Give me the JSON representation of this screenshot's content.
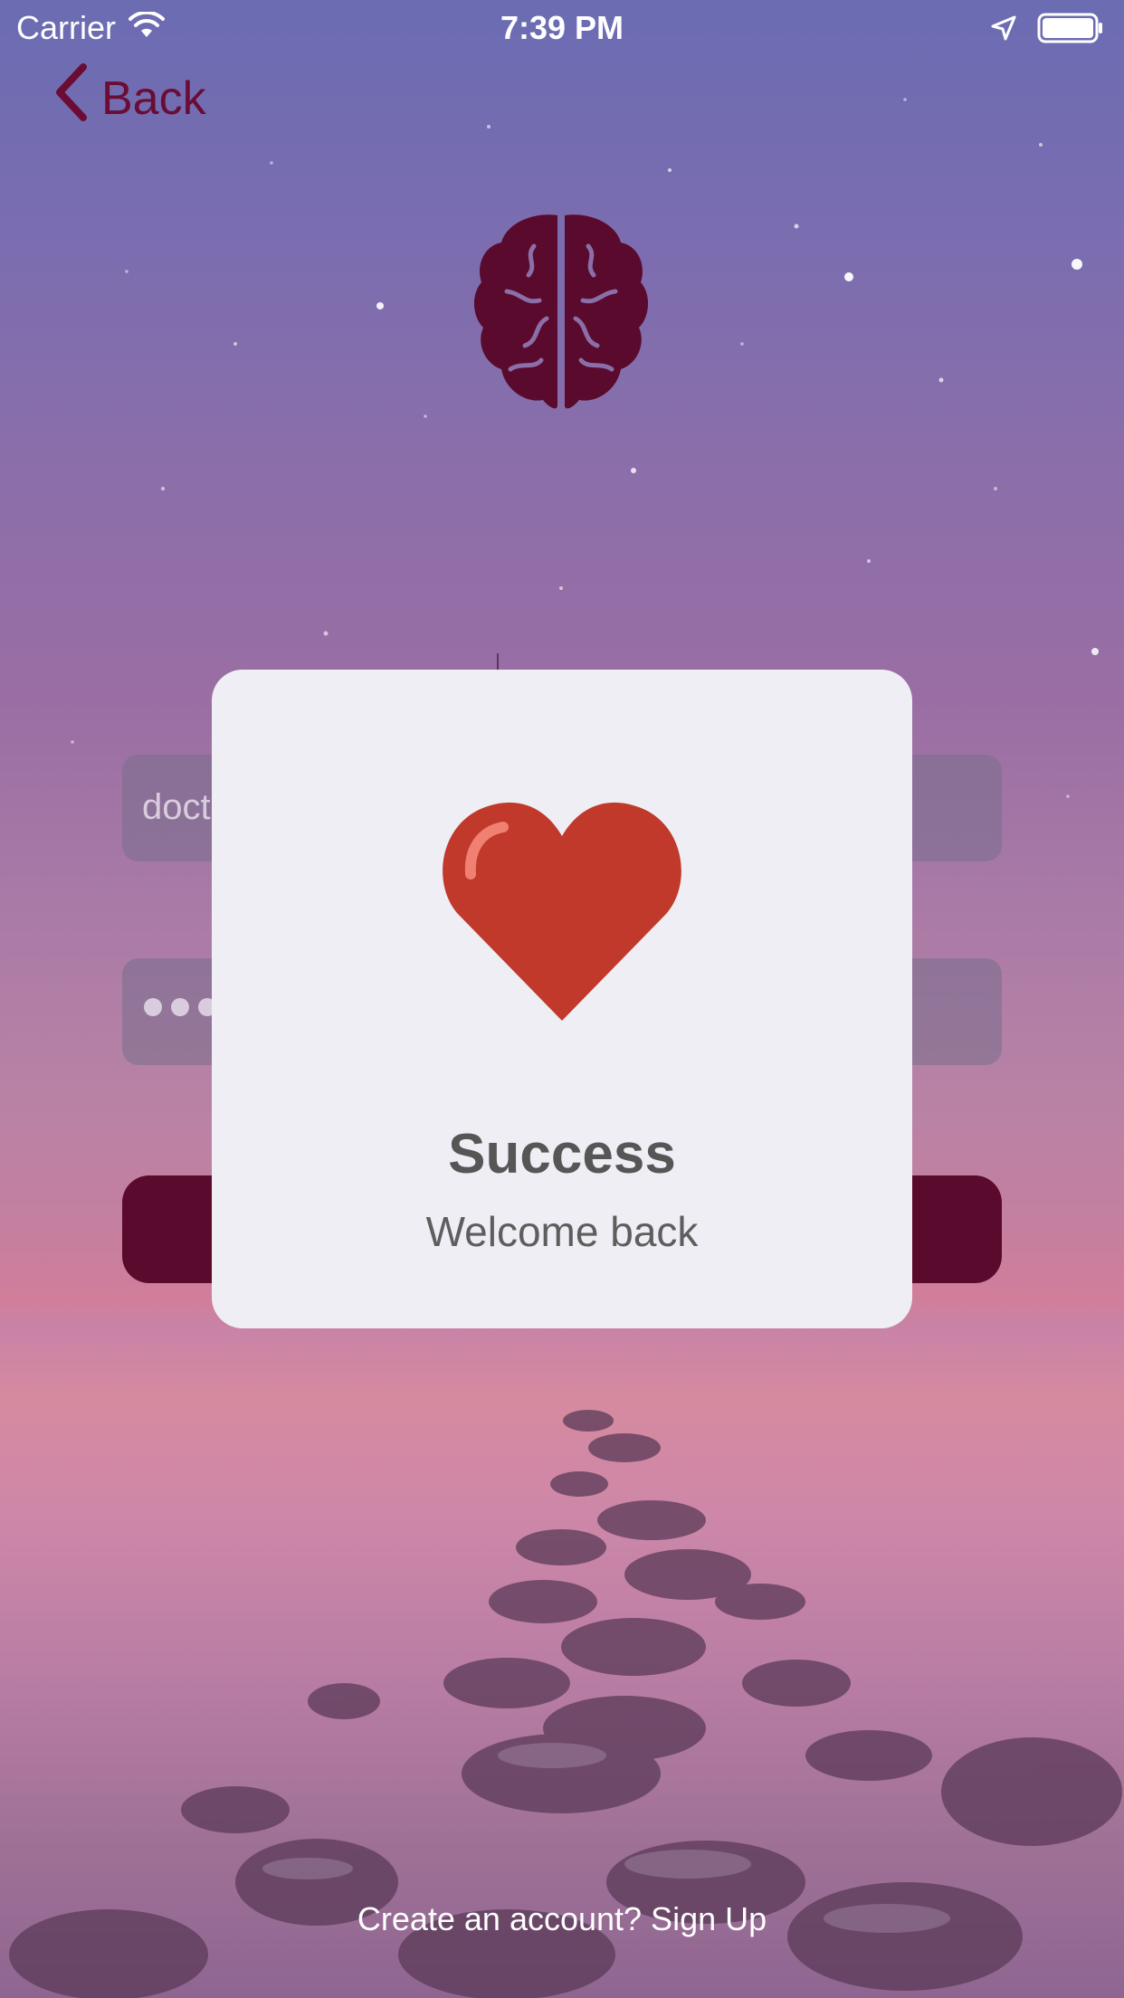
{
  "status_bar": {
    "carrier": "Carrier",
    "time": "7:39 PM",
    "icons": [
      "wifi-icon",
      "location-arrow-icon",
      "battery-icon"
    ]
  },
  "nav": {
    "back_label": "Back",
    "back_icon": "chevron-left-icon"
  },
  "logo": {
    "icon": "brain-icon",
    "color": "#5a0a2c"
  },
  "form": {
    "email_value_visible": "doct",
    "password_dots": 3
  },
  "alert": {
    "icon": "heart-icon",
    "title": "Success",
    "message": "Welcome back"
  },
  "footer": {
    "signup_text": "Create an account? Sign Up"
  },
  "colors": {
    "accent": "#6a0c34",
    "button": "#5a0a2c",
    "heart": "#c0392b",
    "modal_bg": "#efeef4"
  }
}
